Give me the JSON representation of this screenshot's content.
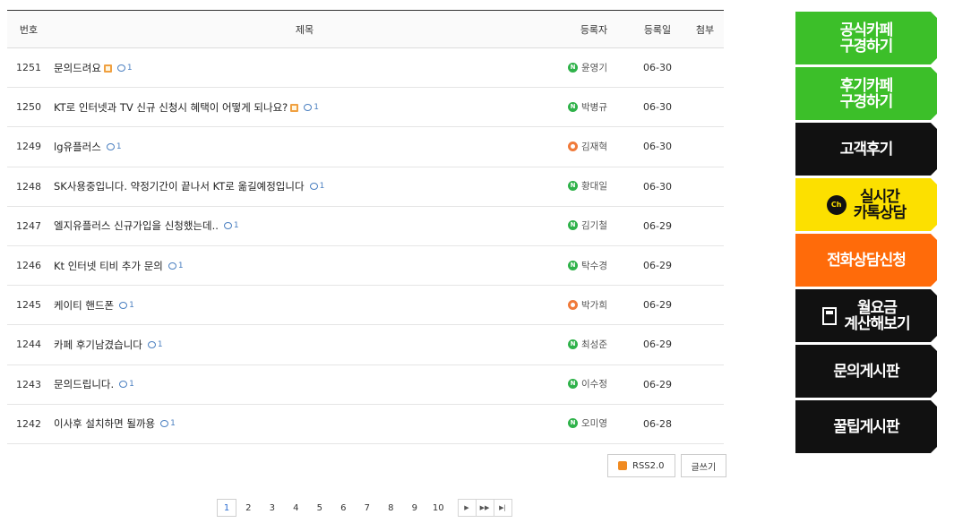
{
  "table": {
    "headers": {
      "num": "번호",
      "title": "제목",
      "writer": "등록자",
      "date": "등록일",
      "file": "첨부"
    },
    "rows": [
      {
        "num": "1251",
        "title": "문의드려요",
        "new": true,
        "comments": "1",
        "writer": "윤영기",
        "badge": "green",
        "date": "06-30"
      },
      {
        "num": "1250",
        "title": "KT로 인터넷과 TV 신규 신청시 혜택이 어떻게 되나요?",
        "new": true,
        "comments": "1",
        "writer": "박병규",
        "badge": "green",
        "date": "06-30"
      },
      {
        "num": "1249",
        "title": "lg유플러스",
        "new": false,
        "comments": "1",
        "writer": "김재혁",
        "badge": "orange",
        "date": "06-30"
      },
      {
        "num": "1248",
        "title": "SK사용중입니다. 약정기간이 끝나서 KT로 옮길예정입니다",
        "new": false,
        "comments": "1",
        "writer": "황대일",
        "badge": "green",
        "date": "06-30"
      },
      {
        "num": "1247",
        "title": "엘지유플러스 신규가입을 신청했는데..",
        "new": false,
        "comments": "1",
        "writer": "김기철",
        "badge": "green",
        "date": "06-29"
      },
      {
        "num": "1246",
        "title": "Kt 인터넷 티비 추가 문의",
        "new": false,
        "comments": "1",
        "writer": "탁수경",
        "badge": "green",
        "date": "06-29"
      },
      {
        "num": "1245",
        "title": "케이티 핸드폰",
        "new": false,
        "comments": "1",
        "writer": "박가희",
        "badge": "orange",
        "date": "06-29"
      },
      {
        "num": "1244",
        "title": "카페 후기남겼습니다",
        "new": false,
        "comments": "1",
        "writer": "최성준",
        "badge": "green",
        "date": "06-29"
      },
      {
        "num": "1243",
        "title": "문의드립니다.",
        "new": false,
        "comments": "1",
        "writer": "이수정",
        "badge": "green",
        "date": "06-29"
      },
      {
        "num": "1242",
        "title": "이사후 설치하면 될까용",
        "new": false,
        "comments": "1",
        "writer": "오미영",
        "badge": "green",
        "date": "06-28"
      }
    ]
  },
  "buttons": {
    "rss": "RSS2.0",
    "write": "글쓰기"
  },
  "pagination": {
    "pages": [
      "1",
      "2",
      "3",
      "4",
      "5",
      "6",
      "7",
      "8",
      "9",
      "10"
    ],
    "current": "1"
  },
  "sidebar": {
    "items": [
      {
        "label": "공식카페\n구경하기",
        "color": "#3cbf29",
        "style": "green"
      },
      {
        "label": "후기카페\n구경하기",
        "color": "#3cbf29",
        "style": "green"
      },
      {
        "label": "고객후기",
        "color": "#111111",
        "style": "black"
      },
      {
        "label": "실시간\n카톡상담",
        "color": "#fce000",
        "style": "yellow",
        "icon": "kakao-chat-icon",
        "icon_text": "Ch"
      },
      {
        "label": "전화상담신청",
        "color": "#ff6b0a",
        "style": "orange"
      },
      {
        "label": "월요금\n계산해보기",
        "color": "#111111",
        "style": "black",
        "icon": "calculator-icon"
      },
      {
        "label": "문의게시판",
        "color": "#111111",
        "style": "black"
      },
      {
        "label": "꿀팁게시판",
        "color": "#111111",
        "style": "black"
      }
    ]
  }
}
